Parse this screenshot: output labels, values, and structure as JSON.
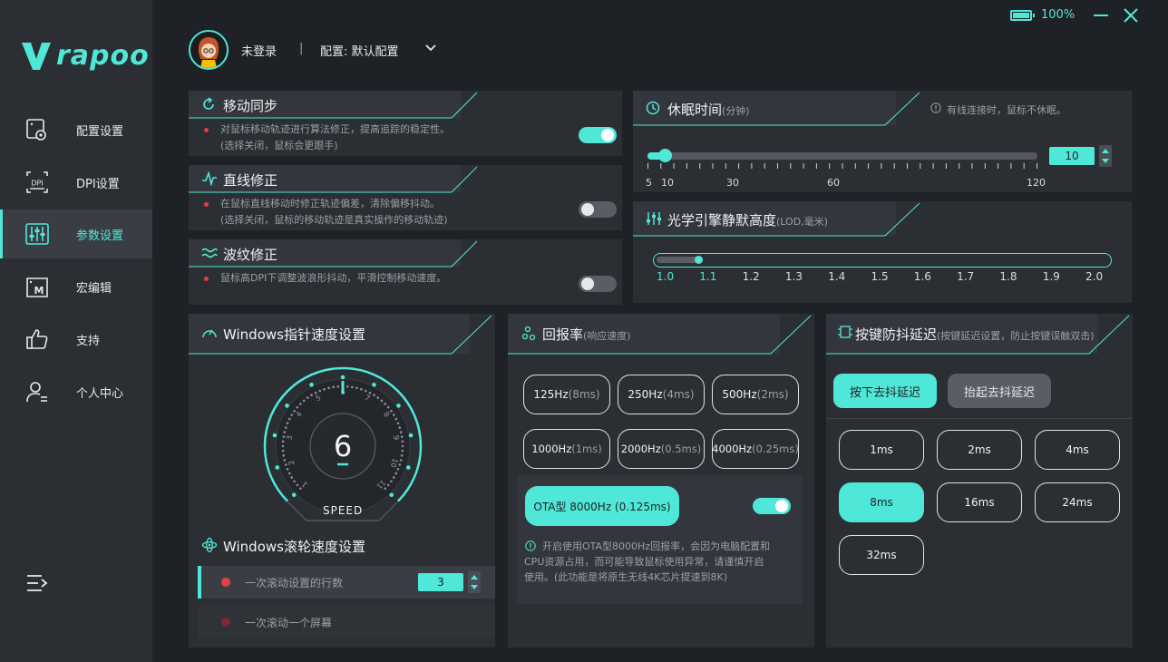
{
  "colors": {
    "accent": "#4fe8d8",
    "bg": "#1e2125",
    "panel": "#2b2e33",
    "danger": "#e0404a"
  },
  "brand": {
    "logo_text": "rapoo"
  },
  "sidebar": {
    "items": [
      {
        "label": "配置设置",
        "icon": "config-icon"
      },
      {
        "label": "DPI设置",
        "icon": "dpi-icon"
      },
      {
        "label": "参数设置",
        "icon": "sliders-icon",
        "active": true
      },
      {
        "label": "宏编辑",
        "icon": "macro-icon"
      },
      {
        "label": "支持",
        "icon": "thumbs-up-icon"
      },
      {
        "label": "个人中心",
        "icon": "user-icon"
      }
    ]
  },
  "topbar": {
    "battery": "100%",
    "user": "未登录",
    "separator": "|",
    "config": "配置: 默认配置"
  },
  "motion_sync": {
    "title": "移动同步",
    "line1": "对鼠标移动轨迹进行算法修正，提高追踪的稳定性。",
    "line2": "(选择关闭，鼠标会更跟手)",
    "enabled": true
  },
  "angle_snap": {
    "title": "直线修正",
    "line1": "在鼠标直线移动时修正轨迹偏差，清除偏移抖动。",
    "line2": "(选择关闭，鼠标的移动轨迹是真实操作的移动轨迹)",
    "enabled": false
  },
  "ripple": {
    "title": "波纹修正",
    "line1": "鼠标高DPI下调整波浪形抖动，平滑控制移动速度。",
    "enabled": false
  },
  "sleep": {
    "title": "休眠时间",
    "unit": "(分钟)",
    "note": "有线连接时，鼠标不休眠。",
    "value": "10",
    "min": 5,
    "max": 120,
    "ticks": [
      "5",
      "10",
      "30",
      "60",
      "120"
    ]
  },
  "lod": {
    "title": "光学引擎静默高度",
    "unit": "(LOD,毫米)",
    "value": 1.1,
    "ticks": [
      "1.0",
      "1.1",
      "1.2",
      "1.3",
      "1.4",
      "1.5",
      "1.6",
      "1.7",
      "1.8",
      "1.9",
      "2.0"
    ]
  },
  "pointer_speed": {
    "title": "Windows指针速度设置",
    "value": "6",
    "label": "SPEED",
    "dial_numbers": [
      "1",
      "2",
      "3",
      "4",
      "5",
      "6",
      "7",
      "8",
      "9",
      "10",
      "11"
    ]
  },
  "scroll_speed": {
    "title": "Windows滚轮速度设置",
    "option1": "一次滚动设置的行数",
    "option1_value": "3",
    "option2": "一次滚动一个屏幕"
  },
  "polling": {
    "title": "回报率",
    "subtitle": "(响应速度)",
    "rates": [
      {
        "hz": "125Hz",
        "ms": "(8ms)"
      },
      {
        "hz": "250Hz",
        "ms": "(4ms)"
      },
      {
        "hz": "500Hz",
        "ms": "(2ms)"
      },
      {
        "hz": "1000Hz",
        "ms": "(1ms)"
      },
      {
        "hz": "2000Hz",
        "ms": "(0.5ms)"
      },
      {
        "hz": "4000Hz",
        "ms": "(0.25ms)"
      }
    ],
    "ota_label": "OTA型 8000Hz (0.125ms)",
    "ota_enabled": true,
    "ota_note_1": "开启使用OTA型8000Hz回报率，会因为电脑配置和",
    "ota_note_2": "CPU资源占用，而可能导致鼠标使用异常，请谨慎开启",
    "ota_note_3": "使用。(此功能是将原生无线4K芯片提速到8K)"
  },
  "debounce": {
    "title": "按键防抖延迟",
    "subtitle": "(按键延迟设置，防止按键误触双击)",
    "tab_press": "按下去抖延迟",
    "tab_release": "抬起去抖延迟",
    "options": [
      "1ms",
      "2ms",
      "4ms",
      "8ms",
      "16ms",
      "24ms",
      "32ms"
    ],
    "selected": "8ms"
  }
}
